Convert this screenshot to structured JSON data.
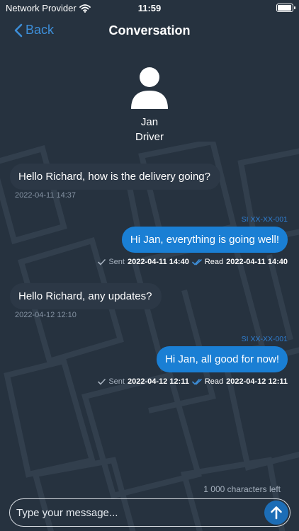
{
  "status_bar": {
    "carrier": "Network Provider",
    "time": "11:59",
    "battery_level": 0.95
  },
  "nav": {
    "back_label": "Back",
    "title": "Conversation"
  },
  "contact": {
    "name": "Jan",
    "role": "Driver"
  },
  "messages": [
    {
      "direction": "incoming",
      "text": "Hello Richard, how is the delivery going?",
      "timestamp": "2022-04-11 14:37"
    },
    {
      "direction": "outgoing",
      "sender": "SI XX-XX-001",
      "text": "Hi Jan, everything is going well!",
      "sent_label": "Sent",
      "sent_time": "2022-04-11 14:40",
      "read_label": "Read",
      "read_time": "2022-04-11 14:40"
    },
    {
      "direction": "incoming",
      "text": "Hello Richard, any updates?",
      "timestamp": "2022-04-12 12:10"
    },
    {
      "direction": "outgoing",
      "sender": "SI XX-XX-001",
      "text": "Hi Jan, all good for now!",
      "sent_label": "Sent",
      "sent_time": "2022-04-12 12:11",
      "read_label": "Read",
      "read_time": "2022-04-12 12:11"
    }
  ],
  "composer": {
    "chars_left": "1 000 characters left",
    "placeholder": "Type your message..."
  },
  "colors": {
    "background": "#26323f",
    "accent": "#1a7fd4",
    "incoming_bubble": "#2c3846"
  },
  "icons": {
    "wifi": "wifi-icon",
    "battery": "battery-icon",
    "back": "chevron-left-icon",
    "avatar": "person-icon",
    "sent": "check-icon",
    "read": "double-check-icon",
    "send": "arrow-up-icon"
  }
}
